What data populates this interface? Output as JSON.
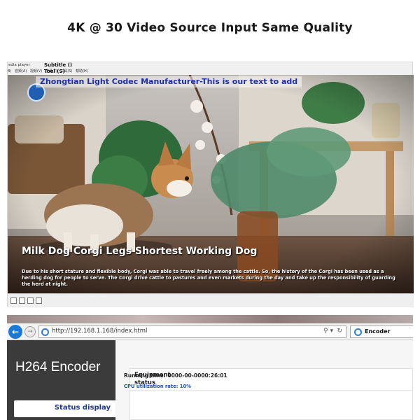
{
  "header": {
    "title": "4K @ 30 Video Source Input Same Quality"
  },
  "player": {
    "window_title": "edia player",
    "menu_items": [
      "B)",
      "音频(A)",
      "视频(V)",
      "字幕(T)",
      "工具(S)",
      "帮助(H)"
    ],
    "subtitle_menu": "Subtitle ()",
    "tool_menu": "Tool (S)",
    "overlay_text": "Zhongtian Light Codec Manufacturer-This is our text to add",
    "caption_title": "Milk Dog Corgi Legs Shortest Working Dog",
    "caption_body": "Due to his short stature and flexible body, Corgi was able to travel freely among the cattle. So, the history of the Corgi has been used as a herding dog for people to serve. The Corgi drive cattle to pastures and even markets during the day and take up the responsibility of guarding the herd at night.",
    "ctrl_icons": [
      "fullscreen-icon",
      "aspect-icon",
      "settings-icon",
      "close-icon"
    ]
  },
  "browser": {
    "url": "http://192.168.1.168/index.html",
    "tab_title": "Encoder",
    "search_icon": "search-icon",
    "refresh_icon": "refresh-icon",
    "back_icon": "back-arrow-icon",
    "forward_icon": "forward-arrow-icon"
  },
  "encoder": {
    "brand": "H264 Encoder",
    "nav_status": "Status display",
    "panel_title_line1": "Equipment",
    "panel_title_line2": "status",
    "running_time": "Running time: 0000-00-0000:26:01",
    "cpu_rate": "CPU utilization rate: 10%"
  },
  "colors": {
    "overlay_text": "#1f2fa8",
    "back_button": "#1a78d6",
    "sidebar_bg": "#3b3b3b",
    "nav_text": "#1f3a8a"
  }
}
